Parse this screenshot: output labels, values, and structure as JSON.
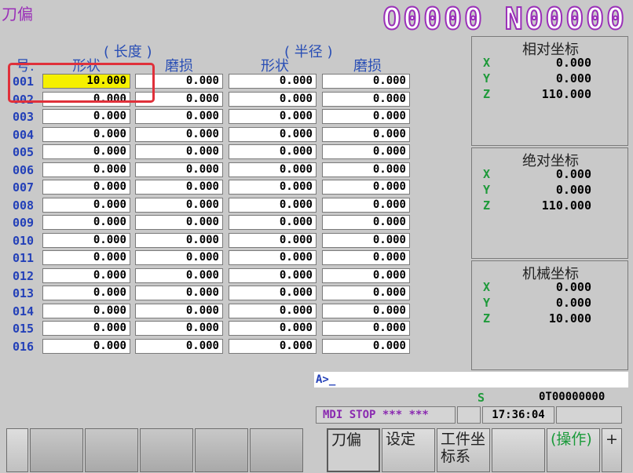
{
  "header": {
    "screen_title": "刀偏",
    "program_no": "O0000 N00000"
  },
  "table": {
    "group_length": "( 长度 )",
    "group_radius": "( 半径 )",
    "col_no": "号.",
    "col_shape1": "形状",
    "col_wear1": "磨损",
    "col_shape2": "形状",
    "col_wear2": "磨损",
    "rows": [
      {
        "no": "001",
        "v": [
          "10.000",
          "0.000",
          "0.000",
          "0.000"
        ]
      },
      {
        "no": "002",
        "v": [
          "0.000",
          "0.000",
          "0.000",
          "0.000"
        ]
      },
      {
        "no": "003",
        "v": [
          "0.000",
          "0.000",
          "0.000",
          "0.000"
        ]
      },
      {
        "no": "004",
        "v": [
          "0.000",
          "0.000",
          "0.000",
          "0.000"
        ]
      },
      {
        "no": "005",
        "v": [
          "0.000",
          "0.000",
          "0.000",
          "0.000"
        ]
      },
      {
        "no": "006",
        "v": [
          "0.000",
          "0.000",
          "0.000",
          "0.000"
        ]
      },
      {
        "no": "007",
        "v": [
          "0.000",
          "0.000",
          "0.000",
          "0.000"
        ]
      },
      {
        "no": "008",
        "v": [
          "0.000",
          "0.000",
          "0.000",
          "0.000"
        ]
      },
      {
        "no": "009",
        "v": [
          "0.000",
          "0.000",
          "0.000",
          "0.000"
        ]
      },
      {
        "no": "010",
        "v": [
          "0.000",
          "0.000",
          "0.000",
          "0.000"
        ]
      },
      {
        "no": "011",
        "v": [
          "0.000",
          "0.000",
          "0.000",
          "0.000"
        ]
      },
      {
        "no": "012",
        "v": [
          "0.000",
          "0.000",
          "0.000",
          "0.000"
        ]
      },
      {
        "no": "013",
        "v": [
          "0.000",
          "0.000",
          "0.000",
          "0.000"
        ]
      },
      {
        "no": "014",
        "v": [
          "0.000",
          "0.000",
          "0.000",
          "0.000"
        ]
      },
      {
        "no": "015",
        "v": [
          "0.000",
          "0.000",
          "0.000",
          "0.000"
        ]
      },
      {
        "no": "016",
        "v": [
          "0.000",
          "0.000",
          "0.000",
          "0.000"
        ]
      }
    ]
  },
  "coords": {
    "relative": {
      "title": "相对坐标",
      "x_label": "X",
      "y_label": "Y",
      "z_label": "Z",
      "x": "0.000",
      "y": "0.000",
      "z": "110.000"
    },
    "absolute": {
      "title": "绝对坐标",
      "x_label": "X",
      "y_label": "Y",
      "z_label": "Z",
      "x": "0.000",
      "y": "0.000",
      "z": "110.000"
    },
    "machine": {
      "title": "机械坐标",
      "x_label": "X",
      "y_label": "Y",
      "z_label": "Z",
      "x": "0.000",
      "y": "0.000",
      "z": "10.000"
    }
  },
  "cmd": {
    "prompt": "A>_"
  },
  "status": {
    "s_label": "S",
    "t_value": "0T00000000",
    "mode": "MDI  STOP *** ***",
    "time": "17:36:04"
  },
  "softkeys": {
    "offset": "刀偏",
    "setting": "设定",
    "workcoord": "工件坐标系",
    "operate": "(操作)",
    "plus": "+"
  },
  "colors": {
    "header_text": "#9a2fb8",
    "row_no": "#2340b8",
    "axis": "#1e9a3a",
    "selected_cell": "#f5f000",
    "highlight_box": "#e0303a"
  }
}
